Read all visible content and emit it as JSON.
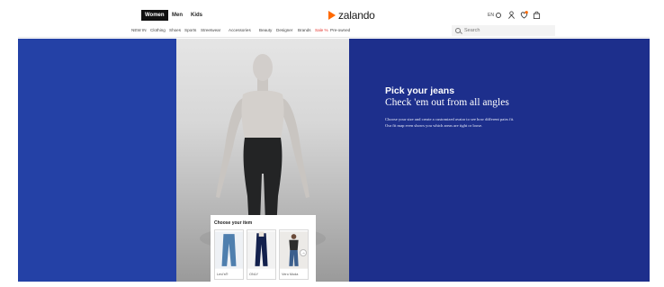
{
  "header": {
    "genders": [
      "Women",
      "Men",
      "Kids"
    ],
    "logo_text": "zalando",
    "language": "EN",
    "nav": [
      "NEW IN",
      "Clothing",
      "Shoes",
      "Sports",
      "Streetwear",
      "Accessories",
      "Beauty",
      "Designer",
      "Brands",
      "Sale %",
      "Pre-owned"
    ],
    "search_placeholder": "Search"
  },
  "hero": {
    "title": "Pick your jeans",
    "subtitle": "Check 'em out from all angles",
    "body": "Choose your size and create a customized avatar to see how different pairs fit. Our fit map even shows you which areas are tight or loose."
  },
  "chooser": {
    "title": "Choose your item",
    "items": [
      "Levi's®",
      "ONLY",
      "Vero Moda"
    ],
    "next_glyph": "→"
  },
  "colors": {
    "left_panel": "#2441a6",
    "right_panel": "#1d2f8c",
    "brand": "#ff6900",
    "sale": "#e4322b"
  }
}
